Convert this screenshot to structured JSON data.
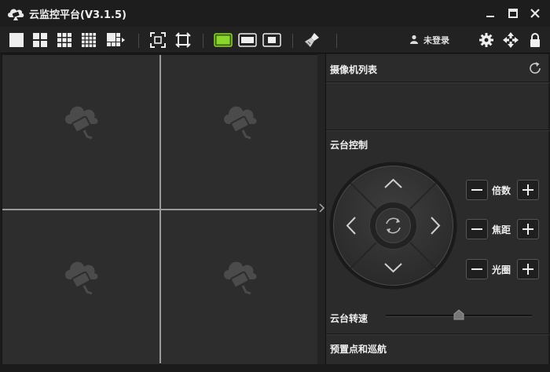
{
  "window": {
    "title": "云监控平台(V3.1.5)"
  },
  "user": {
    "status": "未登录"
  },
  "panel": {
    "camera_list_title": "摄像机列表",
    "ptz_title": "云台控制",
    "ptz_controls": [
      {
        "label": "倍数"
      },
      {
        "label": "焦距"
      },
      {
        "label": "光圈"
      }
    ],
    "speed_label": "云台转速",
    "speed_level": 0.5,
    "presets_title": "预置点和巡航"
  },
  "colors": {
    "accent_green": "#8bd62a",
    "background": "#2b2b2b",
    "grid_line": "#9a9a9a"
  },
  "icons": {
    "placeholder": "cloud-camera-icon",
    "refresh": "refresh-icon"
  }
}
